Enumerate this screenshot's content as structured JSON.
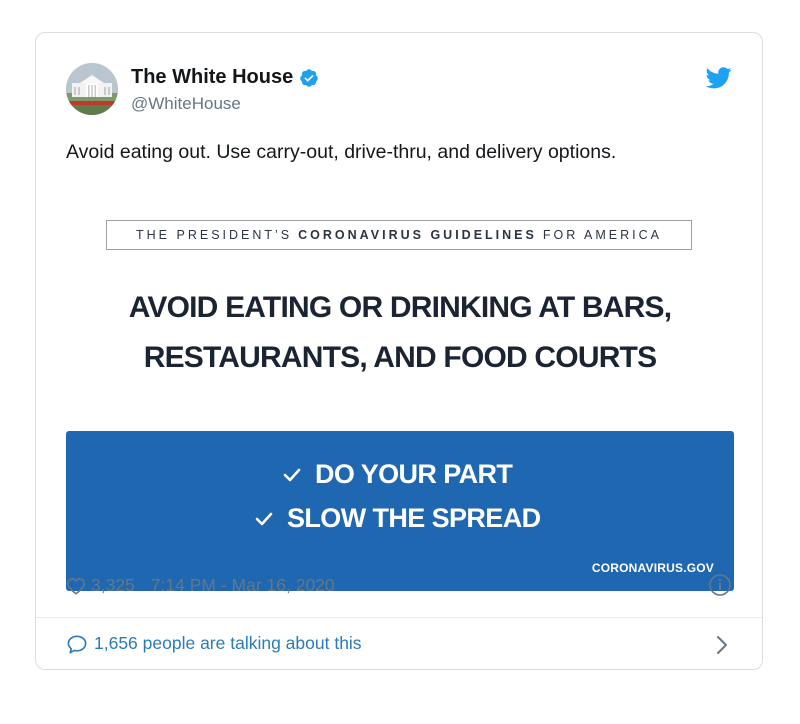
{
  "author": {
    "name": "The White House",
    "handle": "@WhiteHouse"
  },
  "icons": {
    "verified": "verified-badge-icon",
    "brand": "twitter-bird-icon",
    "like": "heart-icon",
    "info": "info-icon",
    "reply": "speech-bubble-icon",
    "more": "chevron-right-icon"
  },
  "tweet": {
    "text": "Avoid eating out. Use carry-out, drive-thru, and delivery options."
  },
  "media": {
    "guideline_prefix": "THE PRESIDENT’S",
    "guideline_bold": "CORONAVIRUS GUIDELINES",
    "guideline_suffix": "FOR AMERICA",
    "headline_line1": "AVOID EATING OR DRINKING AT BARS,",
    "headline_line2": "RESTAURANTS, AND FOOD COURTS",
    "check1": "DO YOUR PART",
    "check2": "SLOW THE SPREAD",
    "source": "CORONAVIRUS.GOV"
  },
  "footer": {
    "likes": "3,325",
    "timestamp": "7:14 PM - Mar 16, 2020",
    "talking": "1,656 people are talking about this"
  },
  "colors": {
    "brand_blue": "#1da1f2",
    "panel_blue": "#1f67b1",
    "link_blue": "#2b7bb9",
    "muted": "#657786"
  }
}
